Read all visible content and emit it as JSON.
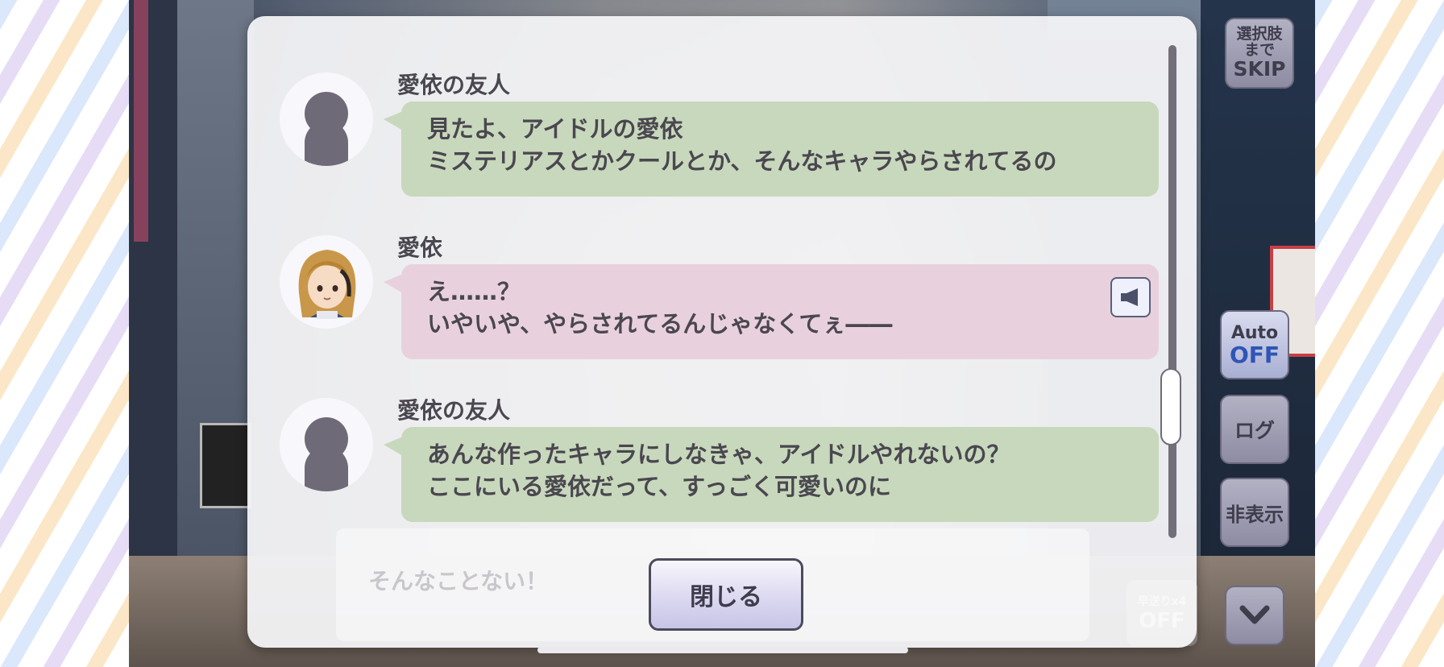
{
  "log": {
    "entries": [
      {
        "speaker": "愛依の友人",
        "avatar": "silhouette-avatar",
        "line1": "見たよ、アイドルの愛依",
        "line2": "ミステリアスとかクールとか、そんなキャラやらされてるの",
        "bubble_color": "#c8d8bc"
      },
      {
        "speaker": "愛依",
        "avatar": "chara-avatar",
        "line1": "え……？",
        "line2": "いやいや、やらされてるんじゃなくてぇ――",
        "bubble_color": "#e8d1dd",
        "voice_icon": "speaker-icon"
      },
      {
        "speaker": "愛依の友人",
        "avatar": "silhouette-avatar",
        "line1": "あんな作ったキャラにしなきゃ、アイドルやれないの？",
        "line2": "ここにいる愛依だって、すっごく可愛いのに",
        "bubble_color": "#c8d8bc"
      }
    ],
    "background_line": "そんなことない！",
    "close_label": "閉じる"
  },
  "controls": {
    "skip_line1": "選択肢",
    "skip_line2": "まで",
    "skip_line3": "SKIP",
    "auto_label": "Auto",
    "auto_state": "OFF",
    "log_label": "ログ",
    "hide_label": "非表示",
    "fast_label": "早送りx4",
    "fast_state": "OFF",
    "down_icon": "chevron-down-icon"
  }
}
